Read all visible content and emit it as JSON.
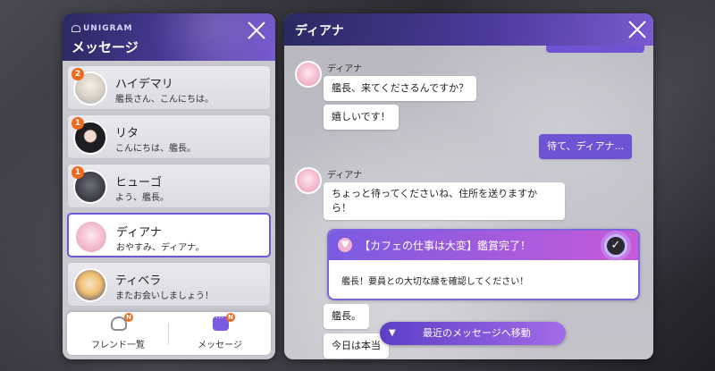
{
  "left": {
    "brand": "UNIGRAM",
    "title": "メッセージ",
    "contacts": [
      {
        "name": "ハイデマリ",
        "message": "艦長さん、こんにちは。",
        "badge": "2"
      },
      {
        "name": "リタ",
        "message": "こんにちは、艦長。",
        "badge": "1"
      },
      {
        "name": "ヒューゴ",
        "message": "よう、艦長。",
        "badge": "1"
      },
      {
        "name": "ディアナ",
        "message": "おやすみ、ディアナ。",
        "badge": ""
      },
      {
        "name": "ティベラ",
        "message": "またお会いしましょう！",
        "badge": ""
      }
    ],
    "footer": {
      "friends_label": "フレンド一覧",
      "messages_label": "メッセージ",
      "friends_badge": "N",
      "messages_badge": "N"
    }
  },
  "chat": {
    "title": "ディアナ",
    "sender": "ディアナ",
    "messages": [
      {
        "text": "艦長、来てくださるんですか？"
      },
      {
        "text": "嬉しいです！"
      },
      {
        "text": "待て、ディアナ..."
      },
      {
        "text": "ちょっと待ってくださいね、住所を送りますか"
      },
      {
        "text": "ら！"
      },
      {
        "text": "艦長。"
      },
      {
        "text": "今日は本当"
      }
    ],
    "notice": {
      "title": "【カフェの仕事は大変】鑑賞完了！",
      "body": "艦長！要員との大切な縁を確認してください！"
    },
    "jump_button": "最近のメッセージへ移動"
  },
  "colors": {
    "accent": "#6e53d2",
    "header": "#3b2f85",
    "badge": "#ee6a1f"
  },
  "icons": [
    "close-icon",
    "heart-icon",
    "check-icon",
    "friends-icon",
    "message-icon",
    "chevron-down-icon"
  ]
}
